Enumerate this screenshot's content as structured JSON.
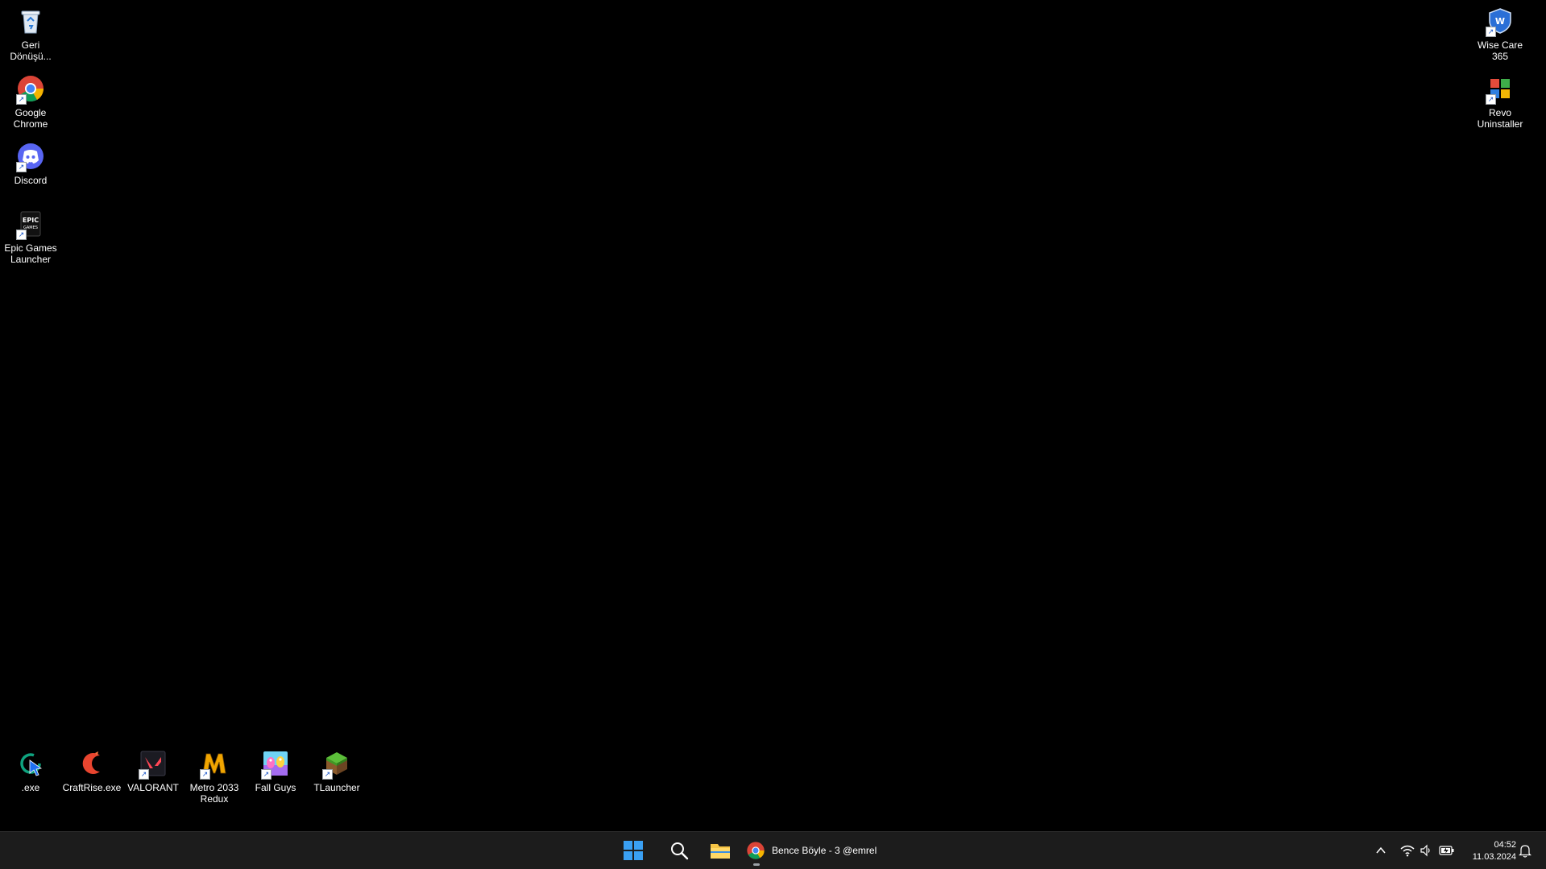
{
  "desktop": {
    "background_color": "#000000",
    "icons_left": [
      {
        "label": "Geri Dönüşü...",
        "icon": "recycle-bin-icon"
      },
      {
        "label": "Google Chrome",
        "icon": "chrome-icon"
      },
      {
        "label": "Discord",
        "icon": "discord-icon"
      },
      {
        "label": "Epic Games Launcher",
        "icon": "epic-games-icon"
      }
    ],
    "icons_right": [
      {
        "label": "Wise Care 365",
        "icon": "wise-care-icon"
      },
      {
        "label": "Revo Uninstaller",
        "icon": "revo-uninstaller-icon"
      }
    ],
    "icons_bottom": [
      {
        "label": ".exe",
        "icon": "exe-refresh-icon"
      },
      {
        "label": "CraftRise.exe",
        "icon": "craftrise-icon"
      },
      {
        "label": "VALORANT",
        "icon": "valorant-icon"
      },
      {
        "label": "Metro 2033 Redux",
        "icon": "metro-2033-icon"
      },
      {
        "label": "Fall Guys",
        "icon": "fall-guys-icon"
      },
      {
        "label": "TLauncher",
        "icon": "tlauncher-icon"
      }
    ]
  },
  "taskbar": {
    "background_color": "#1c1c1c",
    "start_icon": "windows-start-icon",
    "search_icon": "search-icon",
    "explorer_icon": "file-explorer-icon",
    "chrome_window_title": "Bence Böyle - 3 @emrel",
    "tray": {
      "icons": [
        "chevron-up-icon",
        "wifi-icon",
        "speaker-icon",
        "battery-icon",
        "notification-bell-icon"
      ],
      "time": "04:52",
      "date": "11.03.2024"
    }
  }
}
